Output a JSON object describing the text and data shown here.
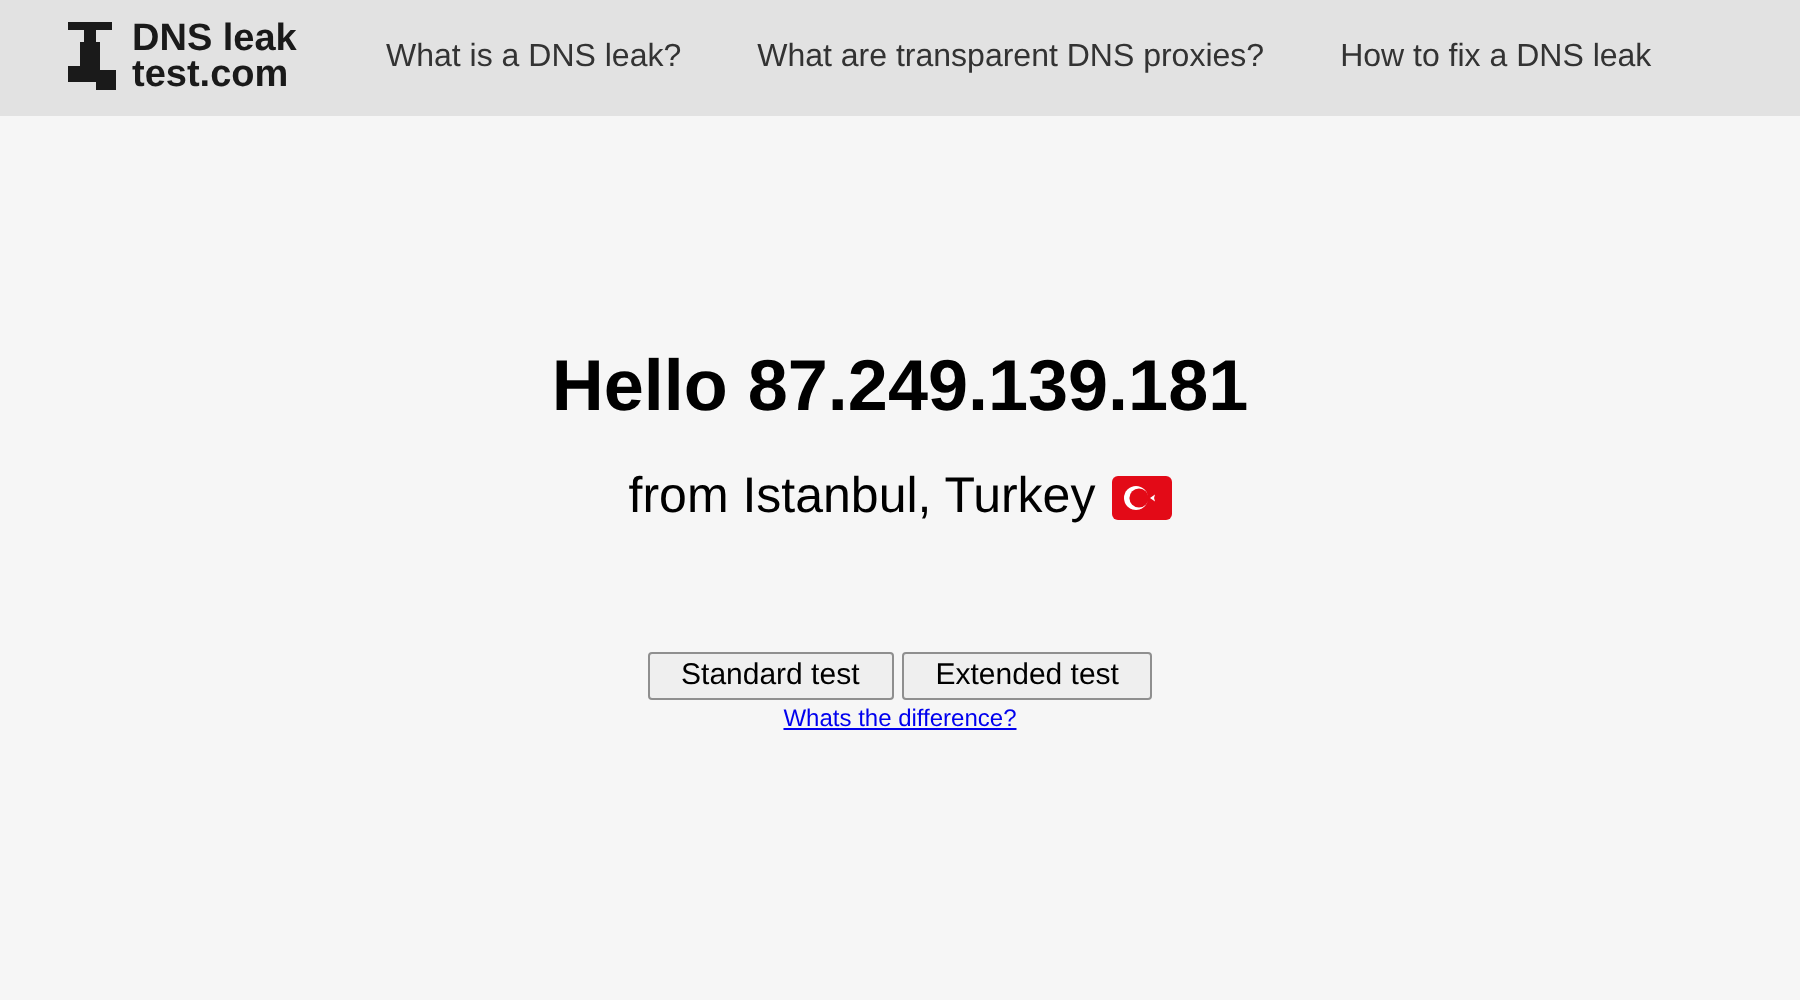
{
  "header": {
    "logo": {
      "line_1": "DNS leak",
      "line_2": "test.com"
    },
    "nav": [
      {
        "label": "What is a DNS leak?"
      },
      {
        "label": "What are transparent DNS proxies?"
      },
      {
        "label": "How to fix a DNS leak"
      }
    ]
  },
  "main": {
    "greeting": "Hello 87.249.139.181",
    "location": "from Istanbul, Turkey",
    "buttons": [
      {
        "label": "Standard test"
      },
      {
        "label": "Extended test"
      }
    ],
    "link": "Whats the difference?"
  }
}
